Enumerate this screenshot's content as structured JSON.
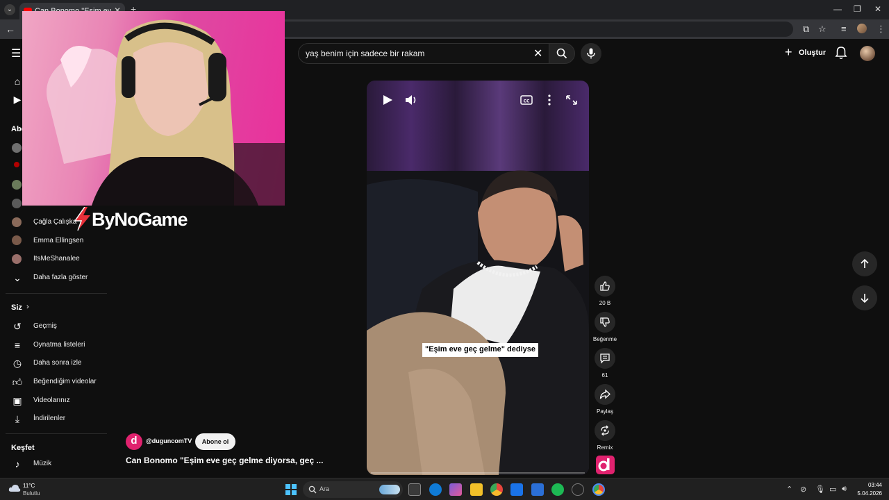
{
  "browser": {
    "tab_title": "Can Bonomo \"Eşim eve geç gel",
    "tab_close": "✕",
    "new_tab": "+"
  },
  "header": {
    "search_query": "yaş benim için sadece bir rakam",
    "create_label": "Oluştur"
  },
  "sidebar": {
    "subscriptions_heading": "Abo",
    "subscriptions": [
      {
        "name": "Çağla Çalışka",
        "avatar_color": "#8a6a5a"
      },
      {
        "name": "Emma Ellingsen",
        "avatar_color": "#7a5a4a"
      },
      {
        "name": "ItsMeShanalee",
        "avatar_color": "#9a6f6a"
      }
    ],
    "show_more": "Daha fazla göster",
    "you_heading": "Siz",
    "you_items": [
      {
        "label": "Geçmiş",
        "icon": "history-icon"
      },
      {
        "label": "Oynatma listeleri",
        "icon": "playlist-icon"
      },
      {
        "label": "Daha sonra izle",
        "icon": "watch-later-icon"
      },
      {
        "label": "Beğendiğim videolar",
        "icon": "liked-icon"
      },
      {
        "label": "Videolarınız",
        "icon": "your-videos-icon"
      },
      {
        "label": "İndirilenler",
        "icon": "download-icon"
      }
    ],
    "explore_heading": "Keşfet",
    "explore_items": [
      {
        "label": "Müzik",
        "icon": "music-icon"
      }
    ]
  },
  "overlay": {
    "sponsor": "ByNoGame"
  },
  "video": {
    "caption": "\"Eşim eve geç gelme\" dediyse",
    "channel_handle": "@duguncomTV",
    "channel_logo_letter": "d",
    "subscribe_label": "Abone ol",
    "title": "Can Bonomo \"Eşim eve geç gelme diyorsa, geç ..."
  },
  "actions": {
    "like_count": "20 B",
    "dislike_label": "Beğenme",
    "comment_count": "61",
    "share_label": "Paylaş",
    "remix_label": "Remix"
  },
  "taskbar": {
    "weather_temp": "11°C",
    "weather_cond": "Bulutlu",
    "search_label": "Ara",
    "time": "03:44",
    "date": "5.04.2026"
  },
  "colors": {
    "brand_pink": "#e0226e",
    "yt_red": "#ff0000",
    "accent_blue": "#4cc2ff"
  }
}
